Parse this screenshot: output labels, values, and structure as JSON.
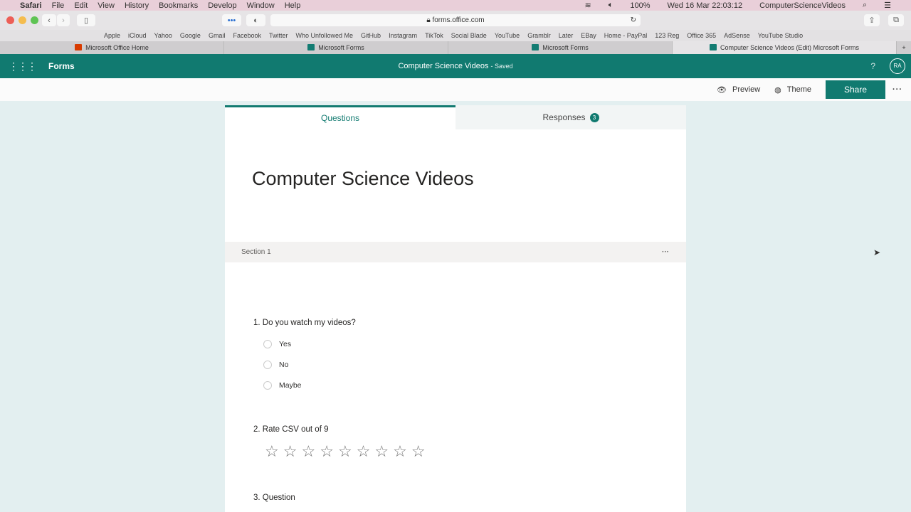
{
  "menubar": {
    "app": "Safari",
    "items": [
      "File",
      "Edit",
      "View",
      "History",
      "Bookmarks",
      "Develop",
      "Window",
      "Help"
    ],
    "battery": "100%",
    "datetime": "Wed 16 Mar  22:03:12",
    "user": "ComputerScienceVideos"
  },
  "browser": {
    "url": "forms.office.com",
    "bookmarks": [
      "Apple",
      "iCloud",
      "Yahoo",
      "Google",
      "Gmail",
      "Facebook",
      "Twitter",
      "Who Unfollowed Me",
      "GitHub",
      "Instagram",
      "TikTok",
      "Social Blade",
      "YouTube",
      "Gramblr",
      "Later",
      "EBay",
      "Home - PayPal",
      "123 Reg",
      "Office 365",
      "AdSense",
      "YouTube Studio"
    ],
    "tabs": [
      "Microsoft Office Home",
      "Microsoft Forms",
      "Microsoft Forms",
      "Computer Science Videos (Edit) Microsoft Forms"
    ]
  },
  "app": {
    "brand": "Forms",
    "title": "Computer Science Videos",
    "status": "- Saved",
    "help": "?",
    "avatar": "RA"
  },
  "commands": {
    "preview": "Preview",
    "theme": "Theme",
    "share": "Share",
    "more": "···"
  },
  "tabs": {
    "questions": "Questions",
    "responses": "Responses",
    "responses_count": "3"
  },
  "form": {
    "title": "Computer Science Videos",
    "section": "Section 1",
    "section_more": "···",
    "q1": {
      "text": "1. Do you watch my videos?",
      "options": [
        "Yes",
        "No",
        "Maybe"
      ]
    },
    "q2": {
      "text": "2. Rate CSV out of 9",
      "stars": 9
    },
    "q3": {
      "text": "3. Question"
    }
  }
}
